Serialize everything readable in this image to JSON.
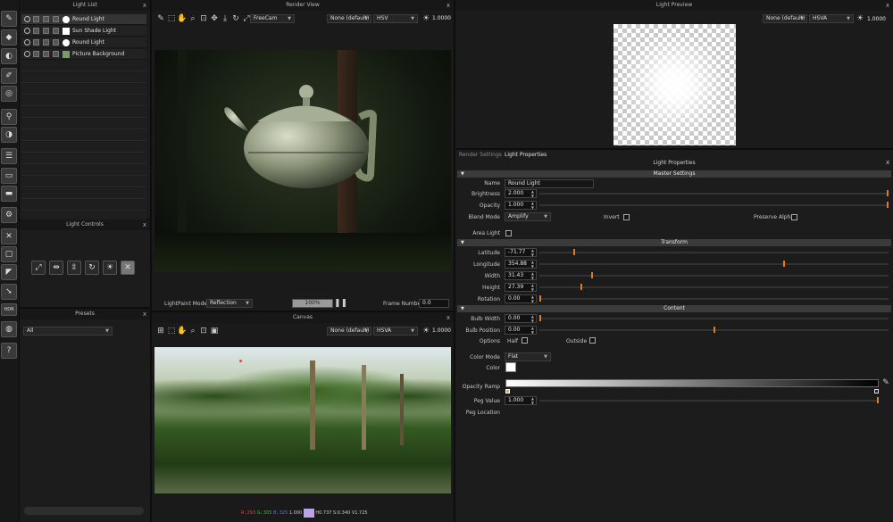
{
  "light_list": {
    "title": "Light List",
    "close": "x",
    "items": [
      {
        "name": "Round Light",
        "swatch": "#ffffff",
        "kind": "round",
        "selected": true
      },
      {
        "name": "Sun Shade Light",
        "swatch": "#ffffff",
        "kind": "square",
        "selected": false
      },
      {
        "name": "Round Light",
        "swatch": "#ffffff",
        "kind": "round",
        "selected": false
      },
      {
        "name": "Picture Background",
        "swatch": "#7a9a6a",
        "kind": "picture",
        "selected": false
      }
    ]
  },
  "light_controls": {
    "title": "Light Controls",
    "close": "x"
  },
  "presets": {
    "title": "Presets",
    "close": "x",
    "filter": "All"
  },
  "render_view": {
    "title": "Render View",
    "close": "x",
    "camera": "FreeCam",
    "profile": "None (default)",
    "color_space": "HSV",
    "exposure": "1.0000",
    "mode_label": "LightPaint Mode",
    "mode_value": "Reflection",
    "progress_label": "100%",
    "progress": 1.0,
    "frame_label": "Frame Number",
    "frame_value": "0.0"
  },
  "canvas": {
    "title": "Canvas",
    "close": "x",
    "profile": "None (default)",
    "color_space": "HSVA",
    "exposure": "1.0000",
    "status": {
      "r": "R:.293",
      "g": "G:.305",
      "b": "B:.325",
      "a": "1.000",
      "swatch": "#b9a3e6",
      "hsv": "H0.737 S:0.340 V1.725"
    }
  },
  "light_preview": {
    "title": "Light Preview",
    "close": "x",
    "profile": "None (default)",
    "color_space": "HSVA",
    "exposure": "1.0000"
  },
  "tabs": [
    {
      "label": "Render Settings",
      "active": false
    },
    {
      "label": "Light Properties",
      "active": true
    }
  ],
  "light_properties": {
    "title": "Light Properties",
    "close": "x",
    "master": {
      "title": "Master Settings",
      "name_label": "Name",
      "name": "Round Light",
      "brightness_label": "Brightness",
      "brightness": "2.000",
      "brightness_slider": 1.0,
      "opacity_label": "Opacity",
      "opacity": "1.000",
      "opacity_slider": 1.0,
      "blend_label": "Blend Mode",
      "blend": "Amplify",
      "invert_label": "Invert",
      "preserve_label": "Preserve Alpha",
      "area_label": "Area Light"
    },
    "transform": {
      "title": "Transform",
      "latitude_label": "Latitude",
      "latitude": "-71.77",
      "latitude_slider": 0.1,
      "longitude_label": "Longitude",
      "longitude": "354.88",
      "longitude_slider": 0.7,
      "width_label": "Width",
      "width": "31.43",
      "width_slider": 0.15,
      "height_label": "Height",
      "height": "27.39",
      "height_slider": 0.12,
      "rotation_label": "Rotation",
      "rotation": "0.00",
      "rotation_slider": 0.0
    },
    "content": {
      "title": "Content",
      "bulb_width_label": "Bulb Width",
      "bulb_width": "0.00",
      "bulb_width_slider": 0.0,
      "bulb_pos_label": "Bulb Position",
      "bulb_pos": "0.00",
      "bulb_pos_slider": 0.5,
      "options_label": "Options",
      "half_label": "Half",
      "outside_label": "Outside",
      "color_mode_label": "Color Mode",
      "color_mode": "Flat",
      "color_label": "Color",
      "color": "#ffffff",
      "ramp_label": "Opacity Ramp",
      "peg_value_label": "Peg Value",
      "peg_value": "1.000",
      "peg_slider": 1.0,
      "peg_location_label": "Peg Location"
    }
  },
  "toolbar": {
    "hdr": "HDR",
    "help": "?"
  }
}
